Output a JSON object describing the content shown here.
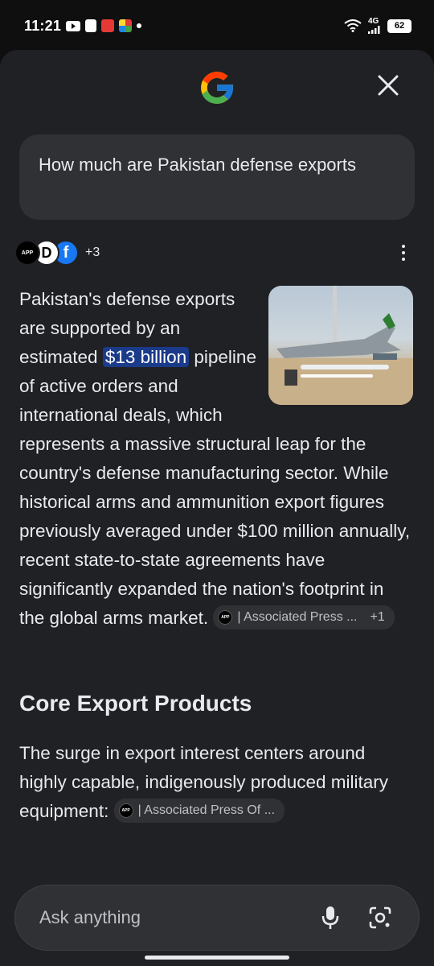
{
  "status_bar": {
    "time": "11:21",
    "network": "4G",
    "battery": "62"
  },
  "header": {
    "logo": "google-g-icon",
    "close": "close-icon"
  },
  "query": {
    "text": "How much are Pakistan defense exports"
  },
  "sources": {
    "avatars": [
      "APP",
      "D",
      "f"
    ],
    "more": "+3"
  },
  "answer": {
    "part1": "Pakistan's defense exports are supported by an estimated ",
    "highlight": "$13 billion",
    "part2": " pipeline of active orders and international deals, which represents a massive structural leap for the country's defense manufacturing sector. While historical arms and ammunition export figures previously averaged under $100 million annually, recent state-to-state agreements have significantly expanded the nation's footprint in the global arms market. ",
    "citation": {
      "logo": "APP",
      "label": "| Associated Press ...",
      "count": "+1"
    }
  },
  "section": {
    "heading": "Core Export Products",
    "text": "The surge in export interest centers around highly capable, indigenously produced military equipment: ",
    "citation": {
      "logo": "APP",
      "label": "| Associated Press Of ..."
    }
  },
  "ask_bar": {
    "placeholder": "Ask anything",
    "mic": "microphone-icon",
    "lens": "camera-lens-icon"
  },
  "colors": {
    "background": "#202124",
    "surface": "#303134",
    "highlight": "#1a3a8a",
    "text": "#e8eaed"
  }
}
